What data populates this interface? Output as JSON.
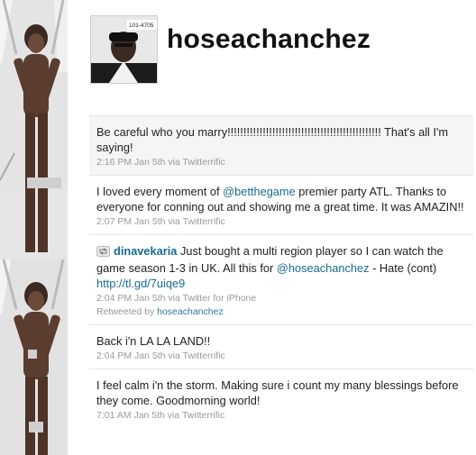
{
  "profile": {
    "username": "hoseachanchez",
    "avatar_badge": "101-4705",
    "avatar_icon": "user-photo"
  },
  "colors": {
    "link": "#1a6a8e",
    "meta": "#999999",
    "highlight": "#f5f5f5"
  },
  "tweets": [
    {
      "text": "Be careful who you marry!!!!!!!!!!!!!!!!!!!!!!!!!!!!!!!!!!!!!!!!!!!!!!!! That's all I'm saying!",
      "meta": "2:16 PM Jan 5th via Twitterrific"
    },
    {
      "text_before": "I loved every moment of ",
      "mention": "@betthegame",
      "text_after": " premier party ATL. Thanks to everyone for conning out and showing me a great time. It was AMAZIN!!",
      "meta": "2:07 PM Jan 5th via Twitterrific"
    },
    {
      "retweet_user": "dinavekaria",
      "text_before": " Just bought a multi region player so I can watch the game season 1-3 in UK. All this for ",
      "mention": "@hoseachanchez",
      "text_middle": " - Hate (cont) ",
      "link": "http://tl.gd/7uiqe9",
      "meta": "2:04 PM Jan 5th via Twitter for iPhone",
      "retweeted_by_label": "Retweeted by ",
      "retweeted_by_user": "hoseachanchez"
    },
    {
      "text": "Back i'n LA LA LAND!!",
      "meta": "2:04 PM Jan 5th via Twitterrific"
    },
    {
      "text": "I feel calm i'n the storm. Making sure i count my many blessings before they come. Goodmorning world!",
      "meta": "7:01 AM Jan 5th via Twitterrific"
    }
  ]
}
